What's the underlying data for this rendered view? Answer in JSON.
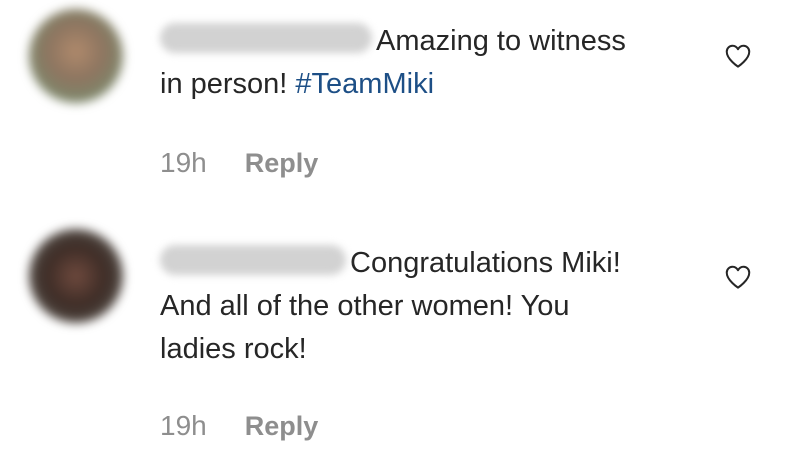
{
  "comments": [
    {
      "line1": "Amazing to witness",
      "line2_prefix": "in person! ",
      "hashtag": "#TeamMiki",
      "time": "19h",
      "reply_label": "Reply"
    },
    {
      "line1": "Congratulations Miki!",
      "line2": "And all of the other women! You",
      "line3": "ladies rock!",
      "time": "19h",
      "reply_label": "Reply"
    }
  ],
  "icons": {
    "like": "heart-outline-icon"
  }
}
